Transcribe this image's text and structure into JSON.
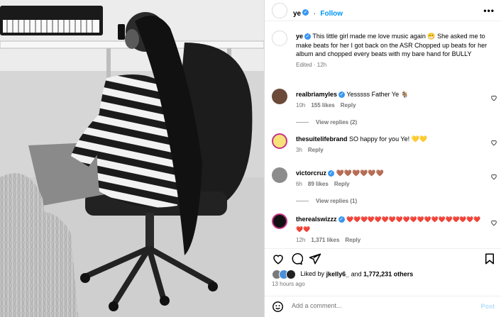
{
  "post": {
    "username": "ye",
    "follow_label": "Follow",
    "more_label": "•••"
  },
  "caption": {
    "username": "ye",
    "text": "This little girl made me love music again 😁 She asked me to make beats for her I got back on the ASR Chopped up beats for her album and chopped every beats with my bare hand for BULLY",
    "meta": "Edited · 12h"
  },
  "comments": [
    {
      "username": "realbriamyles",
      "verified": true,
      "text": "Yesssss Father Ye 🐐",
      "time": "10h",
      "likes": "155 likes",
      "reply_label": "Reply",
      "view_replies": "View replies (2)"
    },
    {
      "username": "thesuitelifebrand",
      "verified": false,
      "text": "SO happy for you Ye! 💛💛",
      "time": "3h",
      "likes": "",
      "reply_label": "Reply",
      "view_replies": ""
    },
    {
      "username": "victorcruz",
      "verified": true,
      "text": "🤎🤎🤎🤎🤎🤎",
      "time": "6h",
      "likes": "89 likes",
      "reply_label": "Reply",
      "view_replies": "View replies (1)"
    },
    {
      "username": "therealswizzz",
      "verified": true,
      "text": "❤️❤️❤️❤️❤️❤️❤️❤️❤️❤️❤️❤️❤️❤️❤️❤️❤️❤️❤️❤️❤️",
      "time": "12h",
      "likes": "1,371 likes",
      "reply_label": "Reply",
      "view_replies": ""
    }
  ],
  "likes_line": {
    "prefix": "Liked by",
    "user": "jkelly6_",
    "and": "and",
    "count": "1,772,231 others"
  },
  "time_ago": "13 hours ago",
  "add_comment": {
    "placeholder": "Add a comment...",
    "post_label": "Post"
  },
  "colors": {
    "link": "#0095f6",
    "verified": "#3897f0",
    "muted": "#737373"
  }
}
